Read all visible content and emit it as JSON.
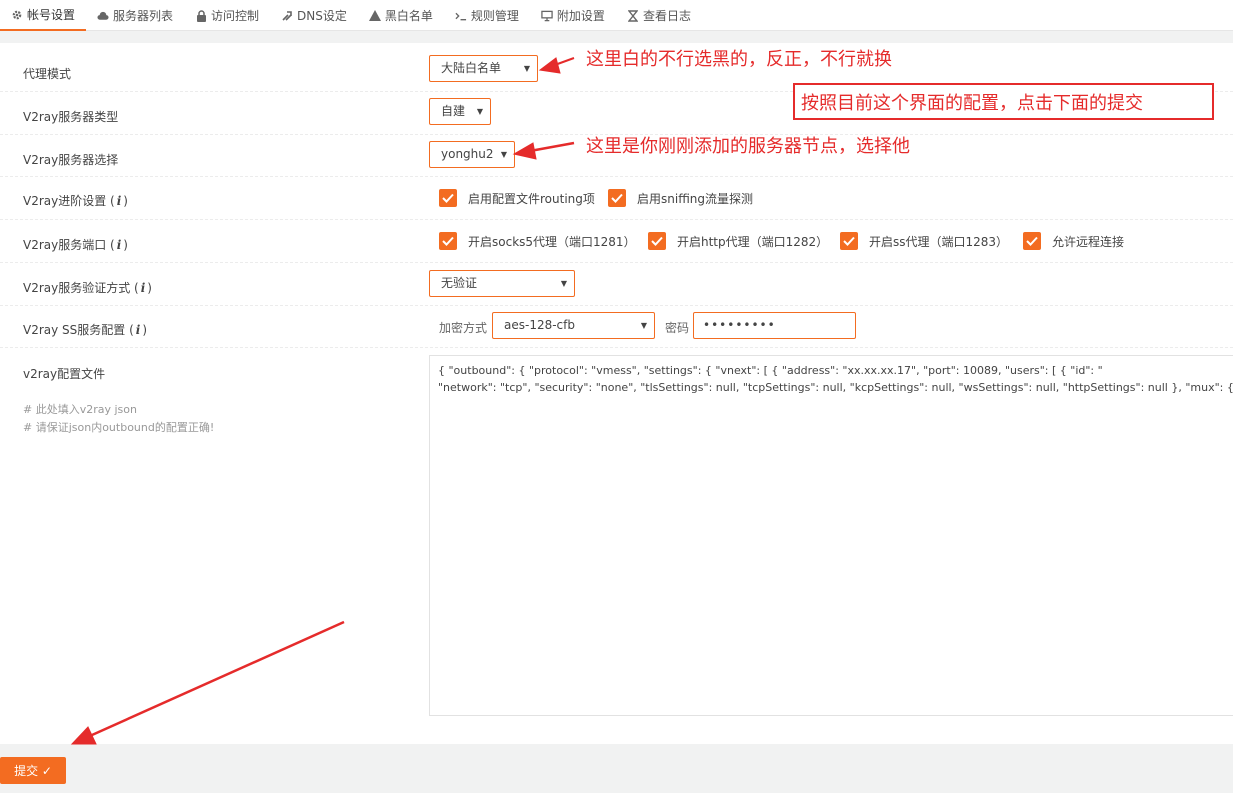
{
  "tabs": [
    {
      "label": "帐号设置",
      "icon": "gear-icon",
      "active": true
    },
    {
      "label": "服务器列表",
      "icon": "cloud-icon"
    },
    {
      "label": "访问控制",
      "icon": "lock-icon"
    },
    {
      "label": "DNS设定",
      "icon": "wrench-icon"
    },
    {
      "label": "黑白名单",
      "icon": "warning-icon"
    },
    {
      "label": "规则管理",
      "icon": "terminal-icon"
    },
    {
      "label": "附加设置",
      "icon": "monitor-icon"
    },
    {
      "label": "查看日志",
      "icon": "hourglass-icon"
    }
  ],
  "form": {
    "proxy_mode": {
      "label": "代理模式",
      "value": "大陆白名单"
    },
    "server_type": {
      "label": "V2ray服务器类型",
      "value": "自建"
    },
    "server_select": {
      "label": "V2ray服务器选择",
      "value": "yonghu2"
    },
    "advanced": {
      "label_prefix": "V2ray进阶设置 (",
      "label_suffix": ")",
      "options": [
        {
          "label": "启用配置文件routing项",
          "checked": true
        },
        {
          "label": "启用sniffing流量探测",
          "checked": true
        }
      ]
    },
    "ports": {
      "label_prefix": "V2ray服务端口 (",
      "label_suffix": ")",
      "options": [
        {
          "label": "开启socks5代理（端口1281）",
          "checked": true
        },
        {
          "label": "开启http代理（端口1282）",
          "checked": true
        },
        {
          "label": "开启ss代理（端口1283）",
          "checked": true
        },
        {
          "label": "允许远程连接",
          "checked": true
        }
      ]
    },
    "auth": {
      "label_prefix": "V2ray服务验证方式 (",
      "label_suffix": ")",
      "value": "无验证"
    },
    "ss": {
      "label_prefix": "V2ray SS服务配置 (",
      "label_suffix": ")",
      "encrypt_label": "加密方式",
      "encrypt_value": "aes-128-cfb",
      "password_label": "密码",
      "password_value": "•••••••••"
    },
    "config": {
      "label": "v2ray配置文件",
      "comments": [
        "# 此处填入v2ray json",
        "# 请保证json内outbound的配置正确!"
      ],
      "lines": [
        "{ \"outbound\": { \"protocol\": \"vmess\", \"settings\": { \"vnext\": [ { \"address\": \"xx.xx.xx.17\", \"port\": 10089, \"users\": [ { \"id\": \"",
        "\"network\": \"tcp\", \"security\": \"none\", \"tlsSettings\": null, \"tcpSettings\": null, \"kcpSettings\": null, \"wsSettings\": null, \"httpSettings\": null }, \"mux\": { \"enabled\": "
      ]
    }
  },
  "info_glyph": "i",
  "submit_label": "提交 ✓",
  "annotations": {
    "a1": "这里白的不行选黑的，反正，不行就换",
    "a2": "按照目前这个界面的配置，点击下面的提交",
    "a3": "这里是你刚刚添加的服务器节点，选择他"
  },
  "colors": {
    "accent": "#f36c21",
    "annotation": "#e52b2b"
  }
}
